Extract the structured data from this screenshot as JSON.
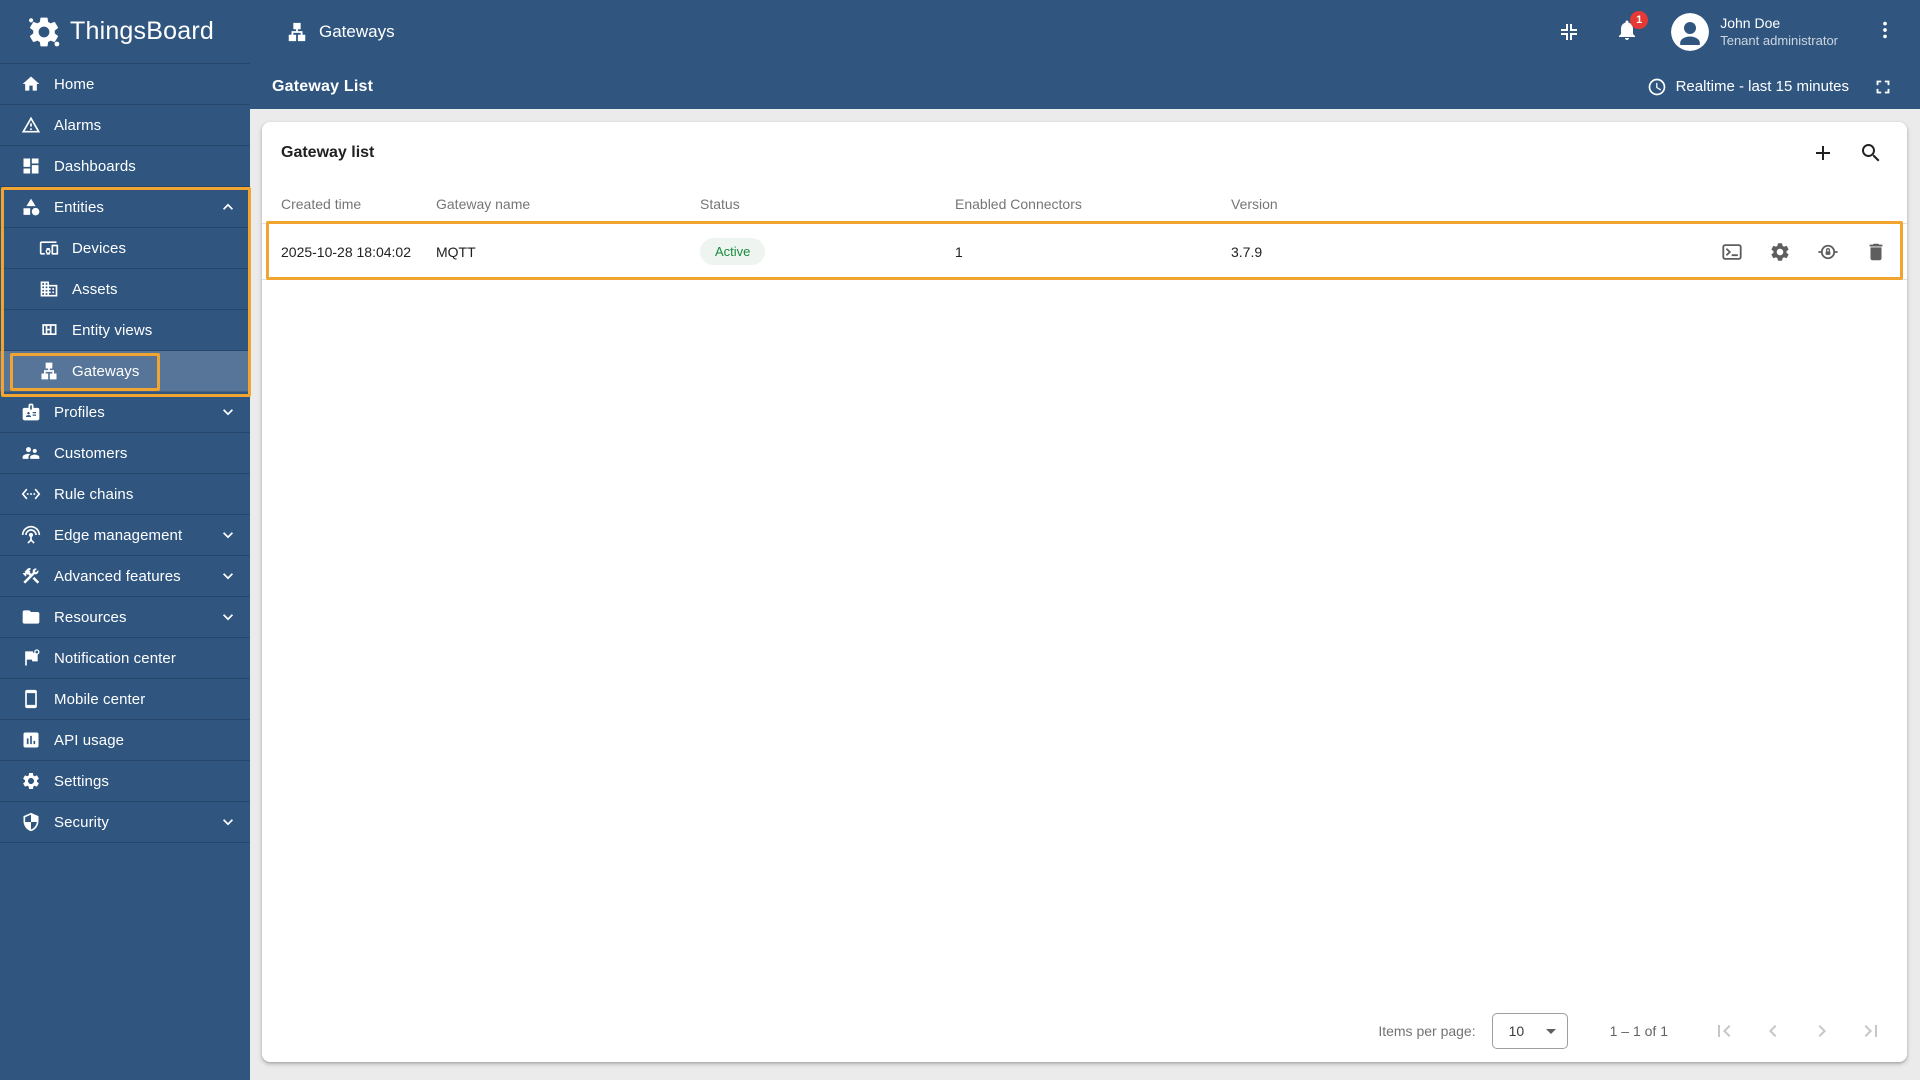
{
  "app": {
    "name": "ThingsBoard"
  },
  "topbar": {
    "page_title": "Gateways",
    "page_icon": "gateways-icon",
    "notifications_badge": "1",
    "user": {
      "name": "John Doe",
      "role": "Tenant administrator"
    },
    "icons": [
      "collapse-icon",
      "bell-icon",
      "avatar",
      "kebab-icon"
    ]
  },
  "toolbar": {
    "title": "Gateway List",
    "timewindow_label": "Realtime - last 15 minutes",
    "icons": [
      "clock-icon",
      "fullscreen-icon"
    ]
  },
  "sidebar": {
    "items": [
      {
        "label": "Home",
        "icon": "home-icon"
      },
      {
        "label": "Alarms",
        "icon": "alarm-icon"
      },
      {
        "label": "Dashboards",
        "icon": "dashboards-icon"
      },
      {
        "label": "Entities",
        "icon": "entities-icon",
        "expanded": true
      },
      {
        "label": "Devices",
        "icon": "devices-icon",
        "child": true
      },
      {
        "label": "Assets",
        "icon": "assets-icon",
        "child": true
      },
      {
        "label": "Entity views",
        "icon": "entity-views-icon",
        "child": true
      },
      {
        "label": "Gateways",
        "icon": "gateways-icon",
        "child": true,
        "selected": true
      },
      {
        "label": "Profiles",
        "icon": "profiles-icon",
        "collapsible": true
      },
      {
        "label": "Customers",
        "icon": "customers-icon"
      },
      {
        "label": "Rule chains",
        "icon": "rule-chains-icon"
      },
      {
        "label": "Edge management",
        "icon": "edge-management-icon",
        "collapsible": true
      },
      {
        "label": "Advanced features",
        "icon": "advanced-features-icon",
        "collapsible": true
      },
      {
        "label": "Resources",
        "icon": "resources-icon",
        "collapsible": true
      },
      {
        "label": "Notification center",
        "icon": "notification-center-icon"
      },
      {
        "label": "Mobile center",
        "icon": "mobile-center-icon"
      },
      {
        "label": "API usage",
        "icon": "api-usage-icon"
      },
      {
        "label": "Settings",
        "icon": "settings-icon"
      },
      {
        "label": "Security",
        "icon": "security-icon",
        "collapsible": true
      }
    ]
  },
  "card": {
    "title": "Gateway list",
    "header_icons": [
      "add-icon",
      "search-icon"
    ],
    "table": {
      "columns": [
        "Created time",
        "Gateway name",
        "Status",
        "Enabled Connectors",
        "Version"
      ],
      "rows": [
        {
          "created_time": "2025-10-28 18:04:02",
          "gateway_name": "MQTT",
          "status": "Active",
          "enabled_connectors": "1",
          "version": "3.7.9",
          "action_icons": [
            "terminal-icon",
            "gear-icon",
            "credentials-icon",
            "trash-icon"
          ]
        }
      ]
    },
    "pagination": {
      "items_per_page_label": "Items per page:",
      "items_per_page_value": "10",
      "range_label": "1 – 1 of 1",
      "nav_icons": [
        "first-page-icon",
        "prev-page-icon",
        "next-page-icon",
        "last-page-icon"
      ]
    }
  },
  "annotations": {
    "highlight_color": "#f1a42f",
    "targets": [
      "entities-menu-group",
      "gateways-menu-item",
      "gateway-table-row"
    ]
  },
  "colors": {
    "primary": "#305680",
    "selected_nav_bg": "#50708f",
    "content_bg": "#ebebeb",
    "active_status_text": "#198a3e",
    "active_status_bg": "#eef4ef",
    "notification_badge": "#e53935",
    "annotation": "#f1a42f"
  }
}
